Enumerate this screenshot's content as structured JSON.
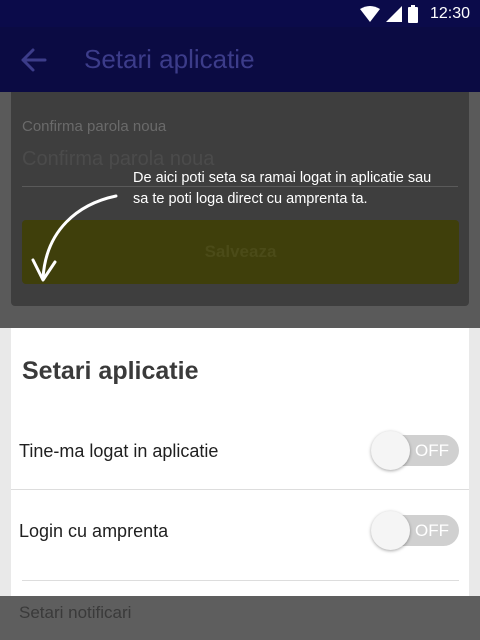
{
  "status_bar": {
    "time": "12:30"
  },
  "app_bar": {
    "title": "Setari aplicatie"
  },
  "form": {
    "confirm_label": "Confirma parola noua",
    "confirm_placeholder": "Confirma parola noua",
    "save_label": "Salveaza"
  },
  "hint": {
    "text": "De aici poti seta sa ramai logat in aplicatie sau sa te poti loga direct cu amprenta ta."
  },
  "settings": {
    "title": "Setari aplicatie",
    "items": [
      {
        "label": "Tine-ma logat in aplicatie",
        "state": "OFF"
      },
      {
        "label": "Login cu amprenta",
        "state": "OFF"
      }
    ]
  },
  "notifications": {
    "label": "Setari notificari"
  },
  "colors": {
    "primary": "#0b0b4a",
    "accent": "#3f3f0b"
  }
}
